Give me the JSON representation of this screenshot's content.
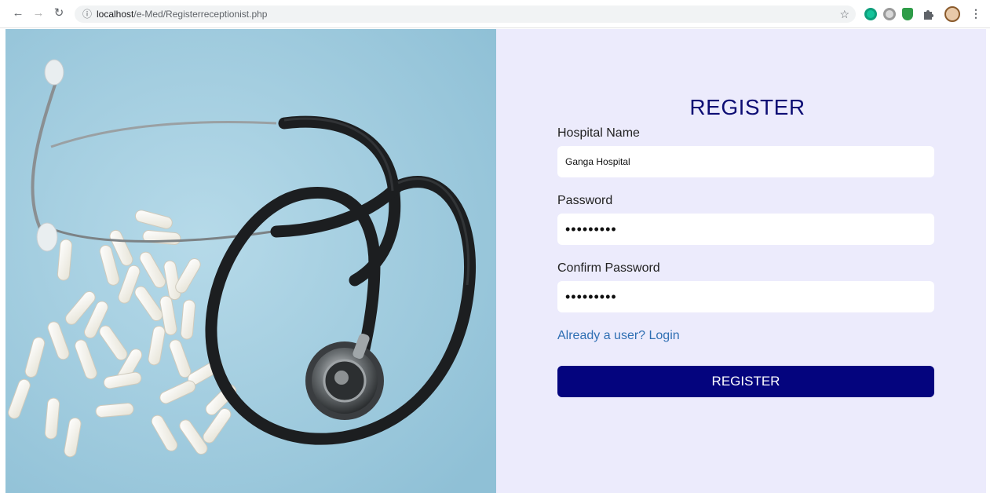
{
  "browser": {
    "url_host": "localhost",
    "url_path": "/e-Med/Registerreceptionist.php"
  },
  "form": {
    "title": "REGISTER",
    "hospital_label": "Hospital Name",
    "hospital_value": "Ganga Hospital",
    "password_label": "Password",
    "password_value": "•••••••••",
    "confirm_label": "Confirm Password",
    "confirm_value": "•••••••••",
    "login_link": "Already a user? Login",
    "submit_label": "REGISTER"
  },
  "colors": {
    "panel_bg": "#ecebfc",
    "title": "#0d0d74",
    "button_bg": "#04047e",
    "link": "#2f6fb3",
    "hero_bg": "#a9cfe0"
  },
  "icons": {
    "back": "arrow-left-icon",
    "forward": "arrow-right-icon",
    "reload": "reload-icon",
    "info": "info-icon",
    "bookmark": "star-icon",
    "extensions": [
      "grammarly-icon",
      "extension-gray-icon",
      "shield-icon",
      "puzzle-icon",
      "profile-avatar-icon"
    ],
    "menu": "kebab-menu-icon"
  }
}
